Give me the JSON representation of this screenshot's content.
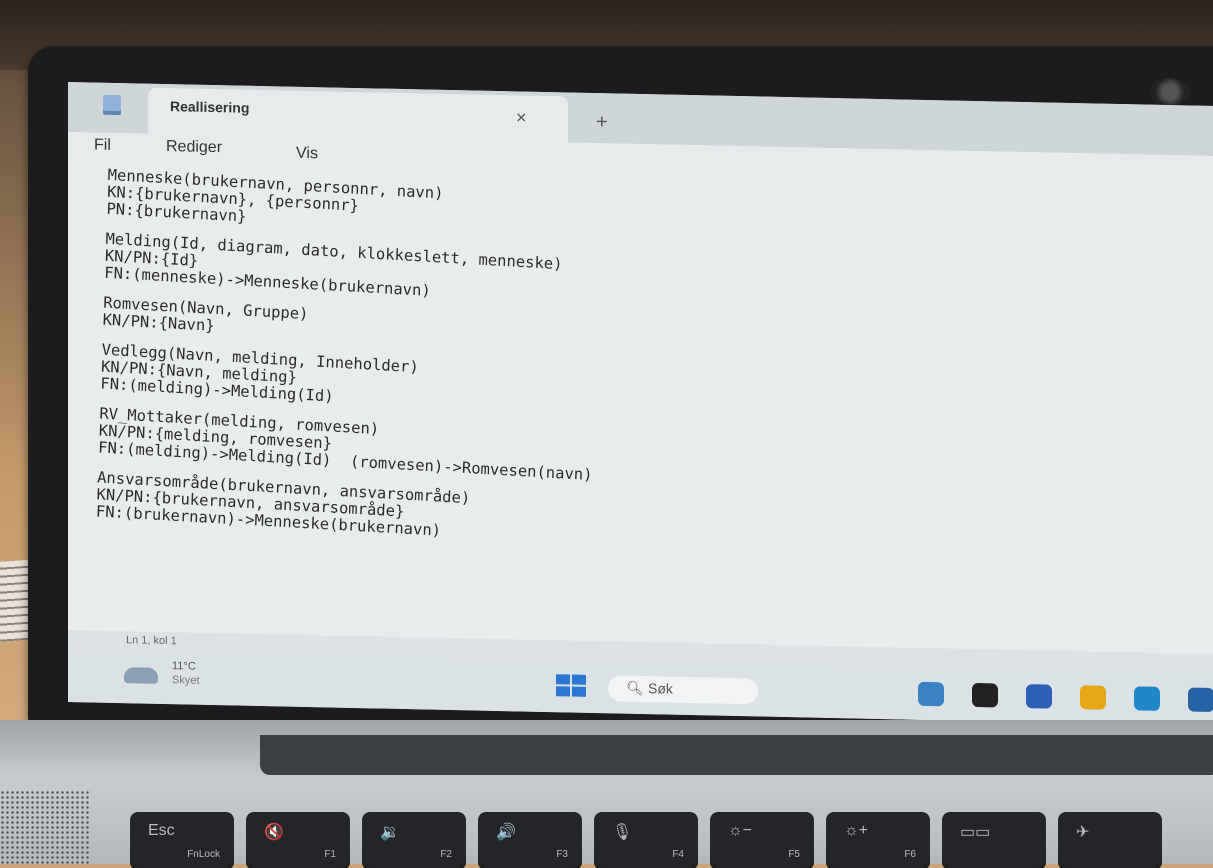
{
  "window": {
    "tab_title": "Reallisering",
    "close_glyph": "×",
    "new_tab_glyph": "+"
  },
  "menu": {
    "file": "Fil",
    "edit": "Rediger",
    "view": "Vis"
  },
  "editor": {
    "blocks": [
      [
        "Menneske(brukernavn, personnr, navn)",
        "KN:{brukernavn}, {personnr}",
        "PN:{brukernavn}"
      ],
      [
        "Melding(Id, diagram, dato, klokkeslett, menneske)",
        "KN/PN:{Id}",
        "FN:(menneske)->Menneske(brukernavn)"
      ],
      [
        "Romvesen(Navn, Gruppe)",
        "KN/PN:{Navn}"
      ],
      [
        "Vedlegg(Navn, melding, Inneholder)",
        "KN/PN:{Navn, melding}",
        "FN:(melding)->Melding(Id)"
      ],
      [
        "RV_Mottaker(melding, romvesen)",
        "KN/PN:{melding, romvesen}",
        "FN:(melding)->Melding(Id)  (romvesen)->Romvesen(navn)"
      ],
      [
        "Ansvarsområde(brukernavn, ansvarsområde)",
        "KN/PN:{brukernavn, ansvarsområde}",
        "FN:(brukernavn)->Menneske(brukernavn)"
      ]
    ]
  },
  "statusbar": {
    "cursor_position": "Ln 1, kol 1"
  },
  "taskbar": {
    "weather_temp": "11°C",
    "weather_desc": "Skyet",
    "search_label": "Søk",
    "search_icon": "search-icon",
    "apps": [
      "copilot-icon",
      "terminal-icon",
      "chat-icon",
      "folder-icon",
      "edge-icon",
      "store-icon"
    ],
    "accent_color": "#2b78d4"
  },
  "keyboard": {
    "keys": [
      {
        "main": "Esc",
        "sub": "FnLock"
      },
      {
        "main": "🔇",
        "sub": "F1"
      },
      {
        "main": "🔉",
        "sub": "F2"
      },
      {
        "main": "🔊",
        "sub": "F3"
      },
      {
        "main": "🎙",
        "sub": "F4"
      },
      {
        "main": "☼−",
        "sub": "F5"
      },
      {
        "main": "☼+",
        "sub": "F6"
      },
      {
        "main": "▭▭",
        "sub": ""
      },
      {
        "main": "✈",
        "sub": ""
      }
    ]
  }
}
